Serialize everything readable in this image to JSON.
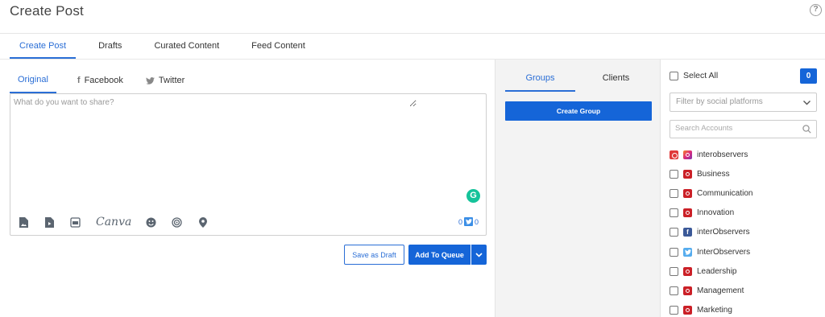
{
  "page": {
    "title": "Create Post"
  },
  "main_tabs": [
    {
      "label": "Create Post",
      "active": true
    },
    {
      "label": "Drafts"
    },
    {
      "label": "Curated Content"
    },
    {
      "label": "Feed Content"
    }
  ],
  "composer": {
    "tabs": [
      {
        "label": "Original",
        "active": true
      },
      {
        "label": "Facebook",
        "icon": "facebook-icon"
      },
      {
        "label": "Twitter",
        "icon": "twitter-icon"
      }
    ],
    "placeholder": "What do you want to share?",
    "canva_label": "Canva",
    "counter": {
      "left": "0",
      "twitter": "0"
    }
  },
  "actions": {
    "save_draft": "Save as Draft",
    "add_to_queue": "Add To Queue"
  },
  "groups_panel": {
    "tabs": [
      {
        "label": "Groups",
        "active": true
      },
      {
        "label": "Clients"
      }
    ],
    "create_group": "Create Group"
  },
  "accounts_panel": {
    "select_all": "Select All",
    "selected_count": "0",
    "filter_placeholder": "Filter by social platforms",
    "search_placeholder": "Search Accounts",
    "accounts": [
      {
        "name": "interobservers",
        "platform": "instagram",
        "checked": true
      },
      {
        "name": "Business",
        "platform": "pinterest"
      },
      {
        "name": "Communication",
        "platform": "pinterest"
      },
      {
        "name": "Innovation",
        "platform": "pinterest"
      },
      {
        "name": "interObservers",
        "platform": "facebook"
      },
      {
        "name": "InterObservers",
        "platform": "twitter"
      },
      {
        "name": "Leadership",
        "platform": "pinterest"
      },
      {
        "name": "Management",
        "platform": "pinterest"
      },
      {
        "name": "Marketing",
        "platform": "pinterest"
      }
    ]
  },
  "colors": {
    "accent": "#1565d8",
    "tab_active": "#2a6ed6",
    "panel_bg": "#f3f3f3"
  }
}
